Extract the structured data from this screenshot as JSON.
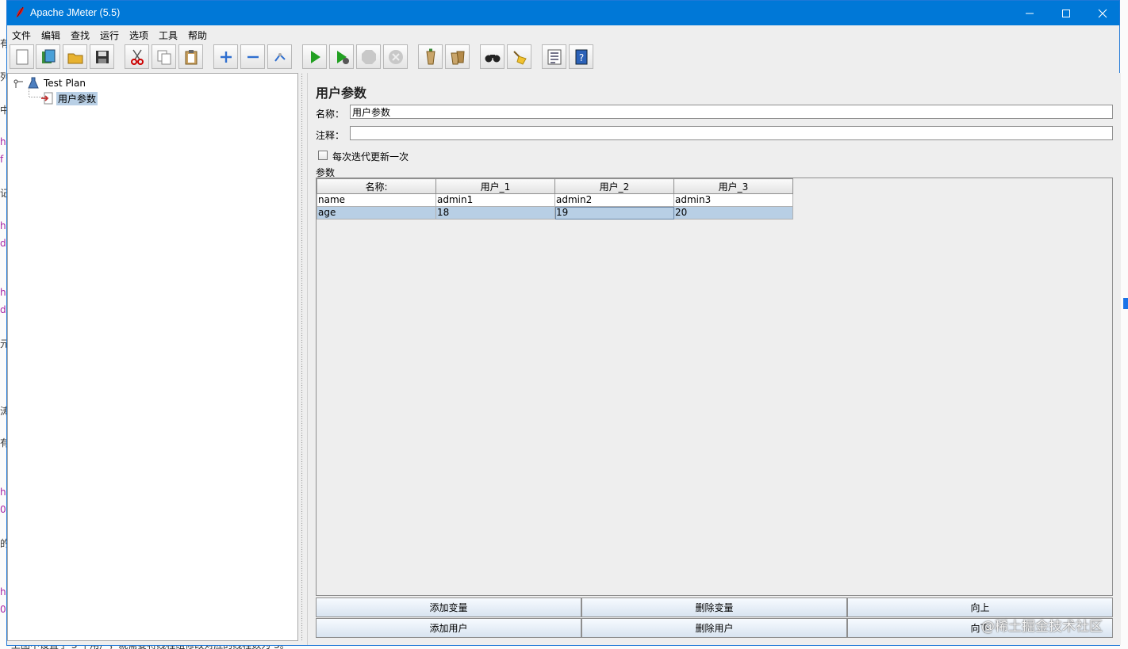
{
  "window": {
    "title": "Apache JMeter (5.5)"
  },
  "menu": [
    "文件",
    "编辑",
    "查找",
    "运行",
    "选项",
    "工具",
    "帮助"
  ],
  "toolbar_icons": [
    "new-icon",
    "templates-icon",
    "open-icon",
    "save-icon",
    "cut-icon",
    "copy-icon",
    "paste-icon",
    "expand-icon",
    "collapse-icon",
    "toggle-icon",
    "start-icon",
    "start-no-pauses-icon",
    "stop-icon",
    "shutdown-icon",
    "clear-icon",
    "clear-all-icon",
    "search-icon",
    "reset-search-icon",
    "function-helper-icon",
    "help-icon"
  ],
  "tree": {
    "root": "Test Plan",
    "child": "用户参数"
  },
  "panel": {
    "title": "用户参数",
    "name_label": "名称：",
    "name_value": "用户参数",
    "comment_label": "注释：",
    "comment_value": "",
    "checkbox_label": "每次迭代更新一次",
    "checkbox_checked": false,
    "params_label": "参数"
  },
  "table": {
    "headers": [
      "名称:",
      "用户_1",
      "用户_2",
      "用户_3"
    ],
    "rows": [
      [
        "name",
        "admin1",
        "admin2",
        "admin3"
      ],
      [
        "age",
        "18",
        "19",
        "20"
      ]
    ],
    "selected_row": 1
  },
  "buttons": {
    "add_variable": "添加变量",
    "delete_variable": "删除变量",
    "move_up": "向上",
    "add_user": "添加用户",
    "delete_user": "删除用户",
    "move_down": "向下"
  },
  "watermark": "@稀土掘金技术社区",
  "colors": {
    "titlebar": "#0078d7",
    "selection": "#b8cfe5"
  }
}
